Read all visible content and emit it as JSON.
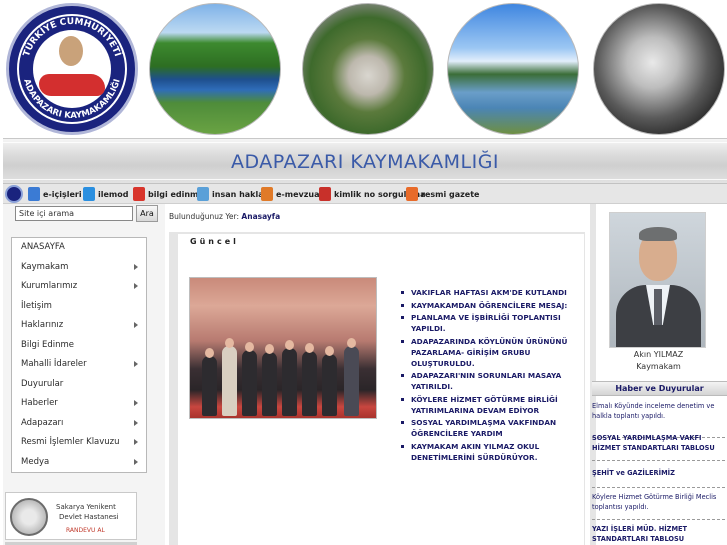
{
  "header": {
    "site_title": "ADAPAZARI KAYMAKAMLIĞI",
    "logo_text_top": "TÜRKİYE CUMHURİYETİ",
    "logo_text_bottom": "ADAPAZARI KAYMAKAMLIĞI"
  },
  "toolbar": {
    "items": [
      {
        "label": "e-içişleri",
        "icon": "e-icisleri-icon",
        "color": "#3b7bd4"
      },
      {
        "label": "ilemod",
        "icon": "ilemod-icon",
        "color": "#2a8fe0"
      },
      {
        "label": "bilgi edinme",
        "icon": "bilgi-edinme-icon",
        "color": "#d8352c"
      },
      {
        "label": "insan hakları",
        "icon": "insan-haklari-icon",
        "color": "#5aa0d8"
      },
      {
        "label": "e-mevzuat",
        "icon": "e-mevzuat-icon",
        "color": "#e07a28"
      },
      {
        "label": "kimlik no sorgulama",
        "icon": "kimlik-no-icon",
        "color": "#c8302a"
      },
      {
        "label": "resmi gazete",
        "icon": "resmi-gazete-icon",
        "color": "#e86b2a"
      }
    ]
  },
  "search": {
    "placeholder": "Site içi arama",
    "button_label": "Ara"
  },
  "menu": {
    "items": [
      {
        "label": "ANASAYFA",
        "has_submenu": false
      },
      {
        "label": "Kaymakam",
        "has_submenu": true
      },
      {
        "label": "Kurumlarımız",
        "has_submenu": true
      },
      {
        "label": "İletişim",
        "has_submenu": false
      },
      {
        "label": "Haklarınız",
        "has_submenu": true
      },
      {
        "label": "Bilgi Edinme",
        "has_submenu": false
      },
      {
        "label": "Mahalli İdareler",
        "has_submenu": true
      },
      {
        "label": "Duyurular",
        "has_submenu": false
      },
      {
        "label": "Haberler",
        "has_submenu": true
      },
      {
        "label": "Adapazarı",
        "has_submenu": true
      },
      {
        "label": "Resmi İşlemler Klavuzu",
        "has_submenu": true
      },
      {
        "label": "Medya",
        "has_submenu": true
      }
    ]
  },
  "banner": {
    "line1": "Sakarya Yenikent",
    "line2": "Devlet Hastanesi",
    "line3": "RANDEVU AL"
  },
  "breadcrumb": {
    "prefix": "Bulunduğunuz Yer:",
    "current": "Anasayfa"
  },
  "content": {
    "section_title": "Güncel",
    "news": [
      "VAKIFLAR HAFTASI AKM'DE KUTLANDI",
      "KAYMAKAMDAN ÖĞRENCİLERE MESAJ:",
      "PLANLAMA VE İŞBİRLİĞİ TOPLANTISI YAPILDI.",
      "ADAPAZARINDA KÖYLÜNÜN ÜRÜNÜNÜ PAZARLAMA- GİRİŞİM GRUBU OLUŞTURULDU.",
      "ADAPAZARI'NIN SORUNLARI MASAYA YATIRILDI.",
      "KÖYLERE HİZMET GÖTÜRME BİRLİĞİ YATIRIMLARINA DEVAM EDİYOR",
      "SOSYAL YARDIMLAŞMA VAKFINDAN ÖĞRENCİLERE YARDIM",
      "KAYMAKAM AKIN YILMAZ OKUL DENETİMLERİNİ SÜRDÜRÜYOR."
    ]
  },
  "sidebar_right": {
    "person_name": "Akın YILMAZ",
    "person_title": "Kaymakam",
    "news_header": "Haber ve Duyurular",
    "news": [
      {
        "text": "Elmalı Köyünde inceleme denetim ve halkla toplantı yapıldı.",
        "bold": false
      },
      {
        "text": "SOSYAL YARDIMLAŞMA VAKFI HİZMET STANDARTLARI TABLOSU",
        "bold": true
      },
      {
        "text": "ŞEHİT ve GAZİLERİMİZ",
        "bold": true
      },
      {
        "text": "Köylere Hizmet Götürme Birliği Meclis toplantısı yapıldı.",
        "bold": false
      },
      {
        "text": "YAZI İŞLERİ MÜD. HİZMET STANDARTLARI TABLOSU",
        "bold": true
      }
    ]
  }
}
